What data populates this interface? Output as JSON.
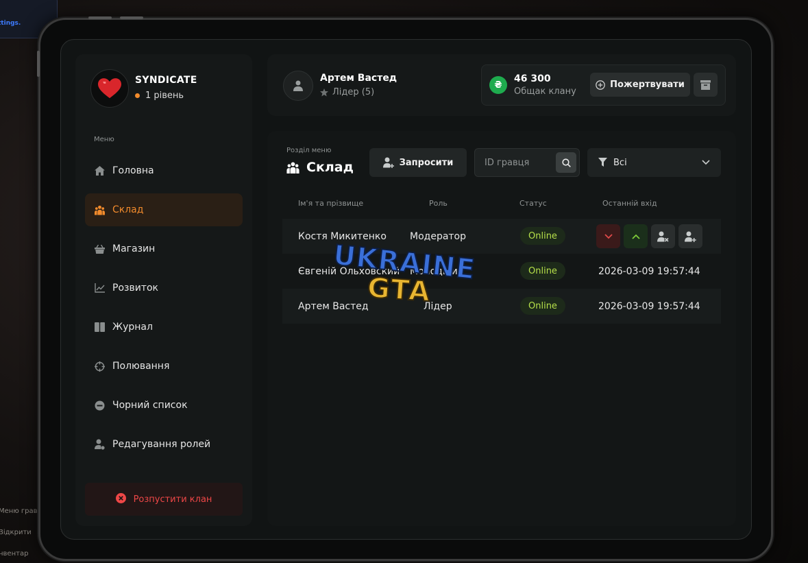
{
  "background": {
    "notice_text": "ttings.",
    "hints": [
      "Меню грав",
      "Відкрити",
      "нвентар"
    ]
  },
  "clan": {
    "name": "SYNDICATE",
    "level": "1 рівень",
    "logo_icon": "heart-icon",
    "accent_color": "#f28b2c"
  },
  "sidebar": {
    "menu_caption": "Меню",
    "items": [
      {
        "label": "Головна",
        "icon": "home-icon",
        "active": false
      },
      {
        "label": "Склад",
        "icon": "users-icon",
        "active": true
      },
      {
        "label": "Магазин",
        "icon": "shop-icon",
        "active": false
      },
      {
        "label": "Розвиток",
        "icon": "chart-icon",
        "active": false
      },
      {
        "label": "Журнал",
        "icon": "book-icon",
        "active": false
      },
      {
        "label": "Полювання",
        "icon": "crosshair-icon",
        "active": false
      },
      {
        "label": "Чорний список",
        "icon": "block-icon",
        "active": false
      },
      {
        "label": "Редагування ролей",
        "icon": "user-edit-icon",
        "active": false
      }
    ],
    "disband_label": "Розпустити клан"
  },
  "header": {
    "user_name": "Артем Вастед",
    "user_role": "Лідер (5)",
    "bank_amount": "46 300",
    "bank_label": "Общак клану",
    "currency_symbol": "₴",
    "donate_label": "Пожертвувати"
  },
  "main": {
    "section_caption": "Розділ меню",
    "section_title": "Склад",
    "invite_label": "Запросити",
    "search_placeholder": "ID гравця",
    "filter_value": "Всі",
    "columns": [
      "Ім'я та прізвище",
      "Роль",
      "Статус",
      "Останній вхід"
    ],
    "members": [
      {
        "name": "Костя Микитенко",
        "role": "Модератор",
        "status": "Online",
        "last_login": ""
      },
      {
        "name": "Євгеній Ольховский",
        "role": "Молодший",
        "status": "Online",
        "last_login": "2026-03-09 19:57:44"
      },
      {
        "name": "Артем Вастед",
        "role": "Лідер",
        "status": "Online",
        "last_login": "2026-03-09 19:57:44"
      }
    ]
  },
  "watermark": {
    "line1": "UKRAINE",
    "line2": "GTA"
  }
}
